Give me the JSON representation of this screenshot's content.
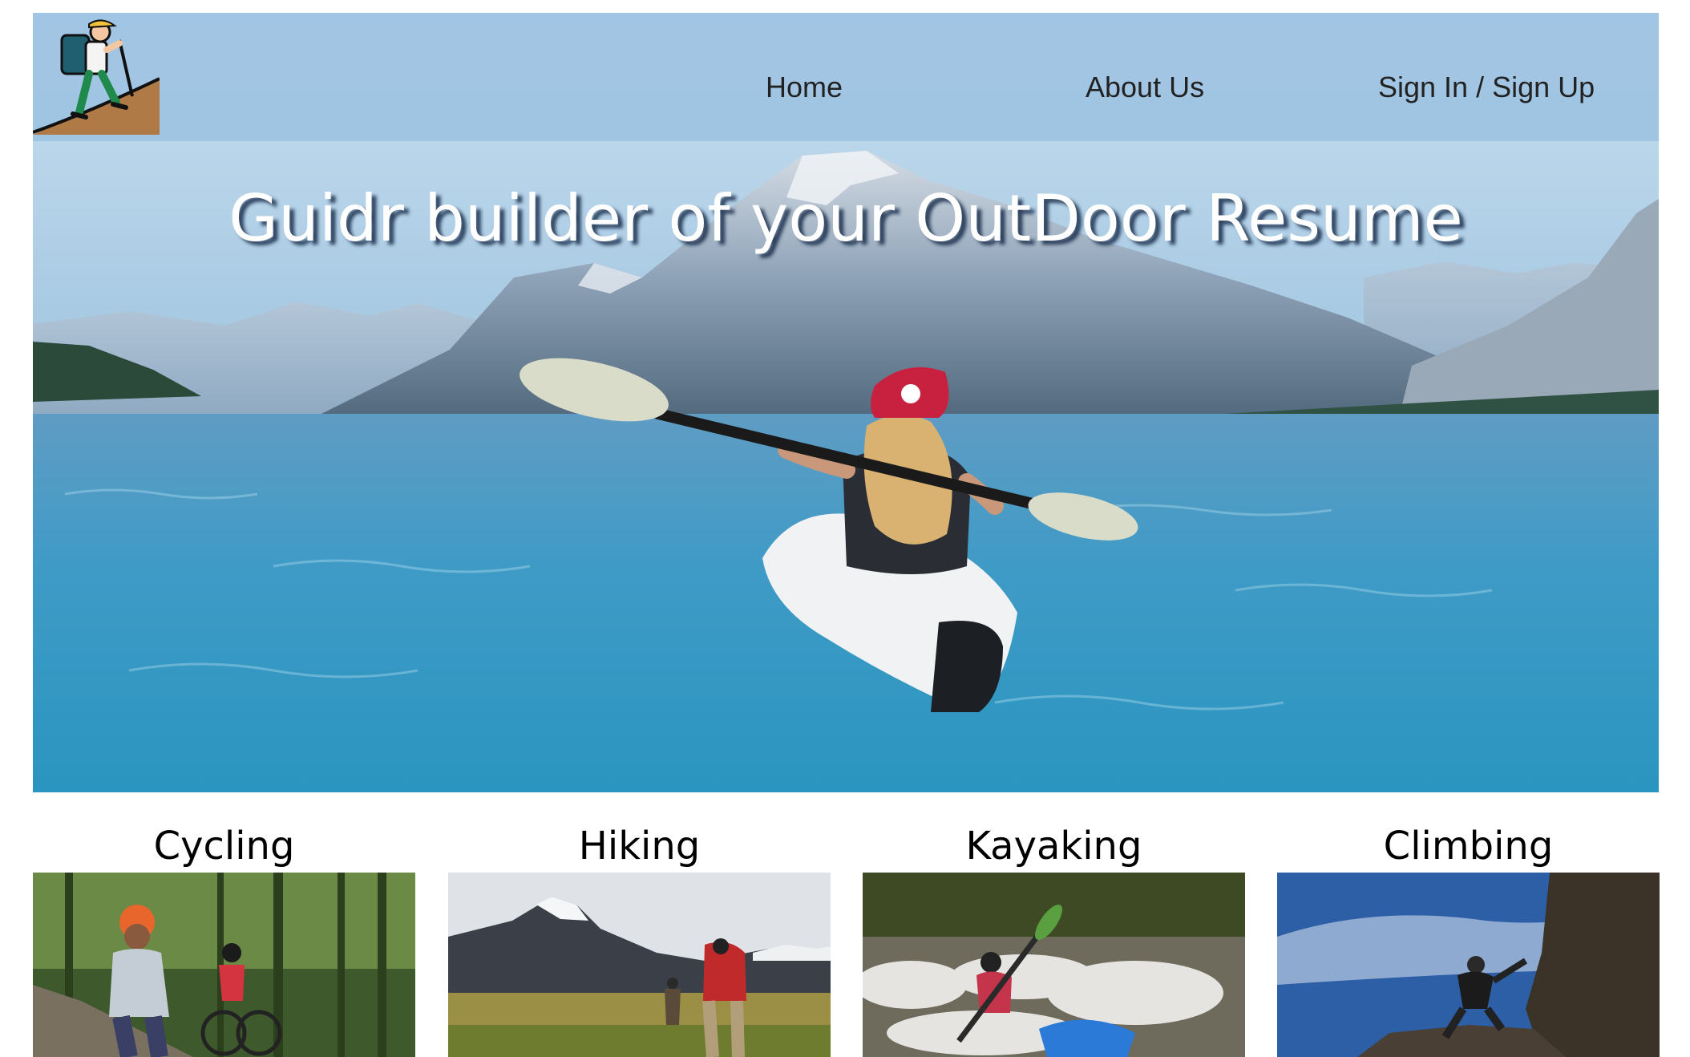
{
  "nav": {
    "logo_icon": "hiker-logo-icon",
    "links": [
      {
        "label": "Home"
      },
      {
        "label": "About Us"
      },
      {
        "label": "Sign In / Sign Up"
      }
    ]
  },
  "hero": {
    "title": "Guidr builder of your OutDoor Resume",
    "image": "kayaker-on-mountain-lake"
  },
  "activities": [
    {
      "title": "Cycling",
      "image": "cyclists-on-forest-trail"
    },
    {
      "title": "Hiking",
      "image": "hikers-in-mountain-valley"
    },
    {
      "title": "Kayaking",
      "image": "kayaker-in-whitewater"
    },
    {
      "title": "Climbing",
      "image": "climber-on-rock-at-sky"
    }
  ],
  "colors": {
    "navbar": "#9ec4e2",
    "title_text": "#ffffff",
    "nav_text": "#222222"
  }
}
